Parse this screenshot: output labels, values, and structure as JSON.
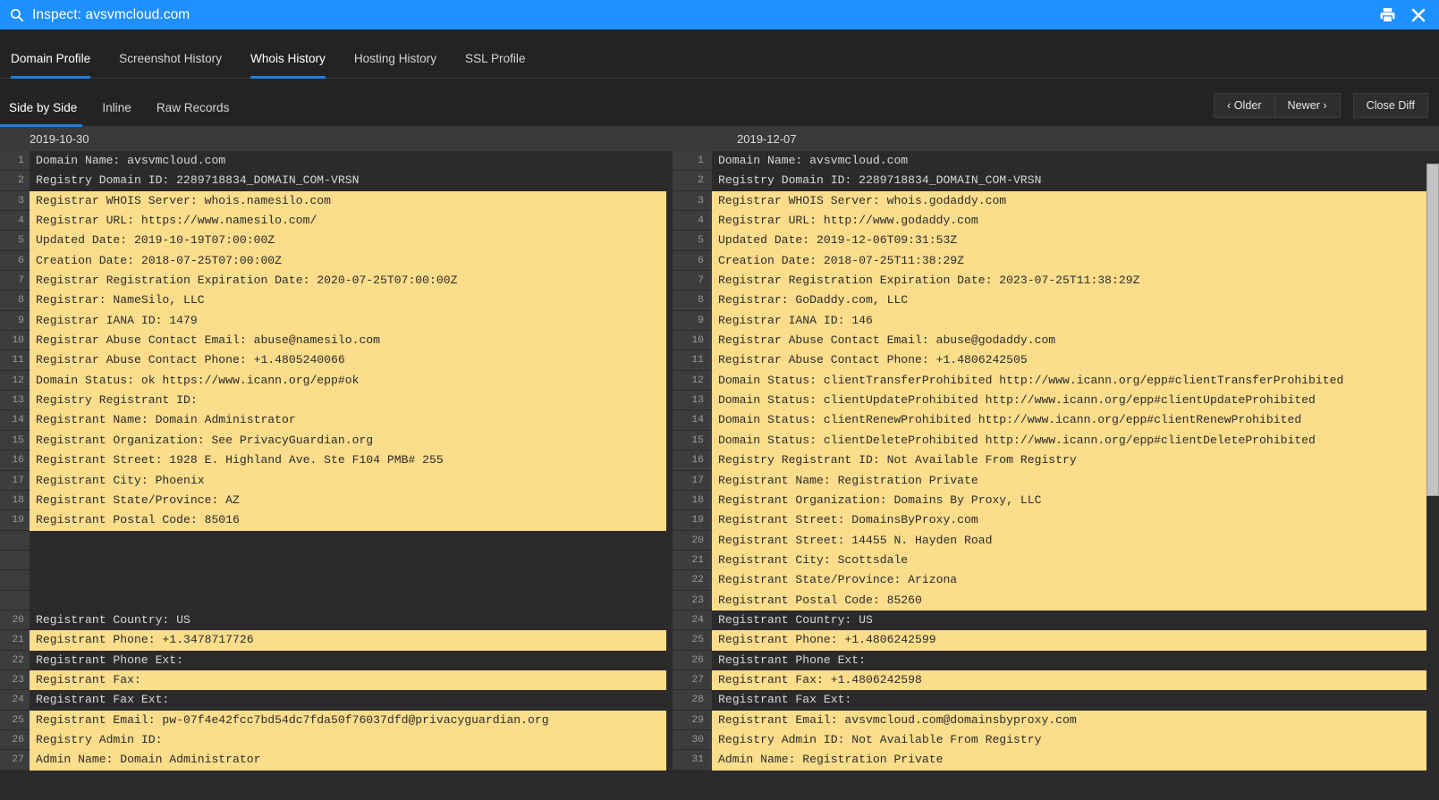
{
  "titlebar": {
    "icon": "search-icon",
    "title": "Inspect: avsvmcloud.com",
    "print_icon": "printer-icon",
    "close_icon": "close-icon",
    "background_color": "#1e90ff"
  },
  "primary_nav": {
    "tabs": [
      {
        "label": "Domain Profile",
        "active": false
      },
      {
        "label": "Screenshot History",
        "active": false
      },
      {
        "label": "Whois History",
        "active": true
      },
      {
        "label": "Hosting History",
        "active": false
      },
      {
        "label": "SSL Profile",
        "active": false
      }
    ],
    "active_underline_color": "#1e7fe0"
  },
  "secondary_bar": {
    "view_tabs": [
      {
        "label": "Side by Side",
        "active": true
      },
      {
        "label": "Inline",
        "active": false
      },
      {
        "label": "Raw Records",
        "active": false
      }
    ],
    "older_button": "‹ Older",
    "newer_button": "Newer ›",
    "close_diff_button": "Close Diff"
  },
  "diff": {
    "left_header": "2019-10-30",
    "right_header": "2019-12-07",
    "highlight_color": "#fbdd8b",
    "context_bg_color": "#2b2b2b",
    "left_lines": [
      {
        "n": "1",
        "text": "Domain Name: avsvmcloud.com",
        "type": "ctx"
      },
      {
        "n": "2",
        "text": "Registry Domain ID: 2289718834_DOMAIN_COM-VRSN",
        "type": "ctx"
      },
      {
        "n": "3",
        "text": "Registrar WHOIS Server: whois.namesilo.com",
        "type": "hl"
      },
      {
        "n": "4",
        "text": "Registrar URL: https://www.namesilo.com/",
        "type": "hl"
      },
      {
        "n": "5",
        "text": "Updated Date: 2019-10-19T07:00:00Z",
        "type": "hl"
      },
      {
        "n": "6",
        "text": "Creation Date: 2018-07-25T07:00:00Z",
        "type": "hl"
      },
      {
        "n": "7",
        "text": "Registrar Registration Expiration Date: 2020-07-25T07:00:00Z",
        "type": "hl"
      },
      {
        "n": "8",
        "text": "Registrar: NameSilo, LLC",
        "type": "hl"
      },
      {
        "n": "9",
        "text": "Registrar IANA ID: 1479",
        "type": "hl"
      },
      {
        "n": "10",
        "text": "Registrar Abuse Contact Email: abuse@namesilo.com",
        "type": "hl"
      },
      {
        "n": "11",
        "text": "Registrar Abuse Contact Phone: +1.4805240066",
        "type": "hl"
      },
      {
        "n": "12",
        "text": "Domain Status: ok https://www.icann.org/epp#ok",
        "type": "hl"
      },
      {
        "n": "13",
        "text": "Registry Registrant ID:",
        "type": "hl"
      },
      {
        "n": "14",
        "text": "Registrant Name: Domain Administrator",
        "type": "hl"
      },
      {
        "n": "15",
        "text": "Registrant Organization: See PrivacyGuardian.org",
        "type": "hl"
      },
      {
        "n": "16",
        "text": "Registrant Street: 1928 E. Highland Ave. Ste F104 PMB# 255",
        "type": "hl"
      },
      {
        "n": "17",
        "text": "Registrant City: Phoenix",
        "type": "hl"
      },
      {
        "n": "18",
        "text": "Registrant State/Province: AZ",
        "type": "hl"
      },
      {
        "n": "19",
        "text": "Registrant Postal Code: 85016",
        "type": "hl"
      },
      {
        "n": "",
        "text": "",
        "type": "gap"
      },
      {
        "n": "",
        "text": "",
        "type": "gap"
      },
      {
        "n": "",
        "text": "",
        "type": "gap"
      },
      {
        "n": "",
        "text": "",
        "type": "gap"
      },
      {
        "n": "20",
        "text": "Registrant Country: US",
        "type": "ctx"
      },
      {
        "n": "21",
        "text": "Registrant Phone: +1.3478717726",
        "type": "hl"
      },
      {
        "n": "22",
        "text": "Registrant Phone Ext:",
        "type": "ctx"
      },
      {
        "n": "23",
        "text": "Registrant Fax:",
        "type": "hl"
      },
      {
        "n": "24",
        "text": "Registrant Fax Ext:",
        "type": "ctx"
      },
      {
        "n": "25",
        "text": "Registrant Email: pw-07f4e42fcc7bd54dc7fda50f76037dfd@privacyguardian.org",
        "type": "hl"
      },
      {
        "n": "26",
        "text": "Registry Admin ID:",
        "type": "hl"
      },
      {
        "n": "27",
        "text": "Admin Name: Domain Administrator",
        "type": "hl"
      }
    ],
    "right_lines": [
      {
        "n": "1",
        "text": "Domain Name: avsvmcloud.com",
        "type": "ctx"
      },
      {
        "n": "2",
        "text": "Registry Domain ID: 2289718834_DOMAIN_COM-VRSN",
        "type": "ctx"
      },
      {
        "n": "3",
        "text": "Registrar WHOIS Server: whois.godaddy.com",
        "type": "hl"
      },
      {
        "n": "4",
        "text": "Registrar URL: http://www.godaddy.com",
        "type": "hl"
      },
      {
        "n": "5",
        "text": "Updated Date: 2019-12-06T09:31:53Z",
        "type": "hl"
      },
      {
        "n": "6",
        "text": "Creation Date: 2018-07-25T11:38:29Z",
        "type": "hl"
      },
      {
        "n": "7",
        "text": "Registrar Registration Expiration Date: 2023-07-25T11:38:29Z",
        "type": "hl"
      },
      {
        "n": "8",
        "text": "Registrar: GoDaddy.com, LLC",
        "type": "hl"
      },
      {
        "n": "9",
        "text": "Registrar IANA ID: 146",
        "type": "hl"
      },
      {
        "n": "10",
        "text": "Registrar Abuse Contact Email: abuse@godaddy.com",
        "type": "hl"
      },
      {
        "n": "11",
        "text": "Registrar Abuse Contact Phone: +1.4806242505",
        "type": "hl"
      },
      {
        "n": "12",
        "text": "Domain Status: clientTransferProhibited http://www.icann.org/epp#clientTransferProhibited",
        "type": "hl"
      },
      {
        "n": "13",
        "text": "Domain Status: clientUpdateProhibited http://www.icann.org/epp#clientUpdateProhibited",
        "type": "hl"
      },
      {
        "n": "14",
        "text": "Domain Status: clientRenewProhibited http://www.icann.org/epp#clientRenewProhibited",
        "type": "hl"
      },
      {
        "n": "15",
        "text": "Domain Status: clientDeleteProhibited http://www.icann.org/epp#clientDeleteProhibited",
        "type": "hl"
      },
      {
        "n": "16",
        "text": "Registry Registrant ID: Not Available From Registry",
        "type": "hl"
      },
      {
        "n": "17",
        "text": "Registrant Name: Registration Private",
        "type": "hl"
      },
      {
        "n": "18",
        "text": "Registrant Organization: Domains By Proxy, LLC",
        "type": "hl"
      },
      {
        "n": "19",
        "text": "Registrant Street: DomainsByProxy.com",
        "type": "hl"
      },
      {
        "n": "20",
        "text": "Registrant Street: 14455 N. Hayden Road",
        "type": "hl"
      },
      {
        "n": "21",
        "text": "Registrant City: Scottsdale",
        "type": "hl"
      },
      {
        "n": "22",
        "text": "Registrant State/Province: Arizona",
        "type": "hl"
      },
      {
        "n": "23",
        "text": "Registrant Postal Code: 85260",
        "type": "hl"
      },
      {
        "n": "24",
        "text": "Registrant Country: US",
        "type": "ctx"
      },
      {
        "n": "25",
        "text": "Registrant Phone: +1.4806242599",
        "type": "hl"
      },
      {
        "n": "26",
        "text": "Registrant Phone Ext:",
        "type": "ctx"
      },
      {
        "n": "27",
        "text": "Registrant Fax: +1.4806242598",
        "type": "hl"
      },
      {
        "n": "28",
        "text": "Registrant Fax Ext:",
        "type": "ctx"
      },
      {
        "n": "29",
        "text": "Registrant Email: avsvmcloud.com@domainsbyproxy.com",
        "type": "hl"
      },
      {
        "n": "30",
        "text": "Registry Admin ID: Not Available From Registry",
        "type": "hl"
      },
      {
        "n": "31",
        "text": "Admin Name: Registration Private",
        "type": "hl"
      }
    ]
  },
  "scrollbar": {
    "name": "vertical-scrollbar"
  }
}
